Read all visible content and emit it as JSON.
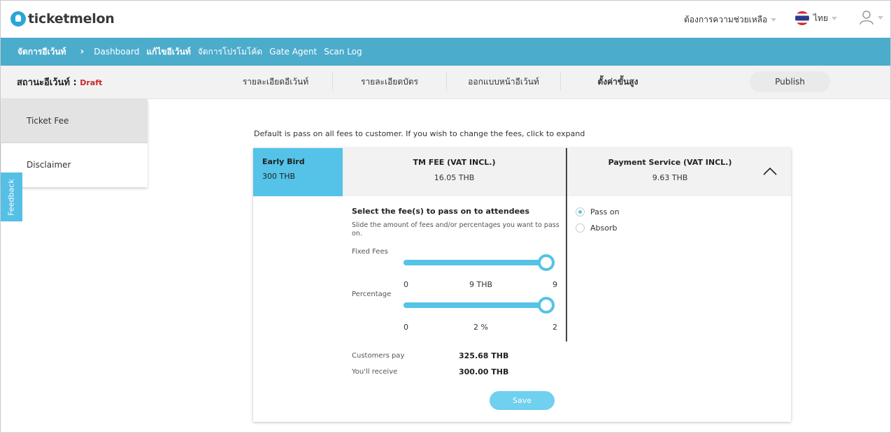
{
  "header": {
    "logo_text": "ticketmelon",
    "help_label": "ต้องการความช่วยเหลือ",
    "language_label": "ไทย"
  },
  "nav": {
    "root": "จัดการอีเว้นท์",
    "items": [
      {
        "label": "Dashboard",
        "active": false
      },
      {
        "label": "แก้ไขอีเว้นท์",
        "active": true
      },
      {
        "label": "จัดการโปรโมโค้ด",
        "active": false
      },
      {
        "label": "Gate Agent",
        "active": false
      },
      {
        "label": "Scan Log",
        "active": false
      }
    ]
  },
  "status": {
    "label": "สถานะอีเว้นท์ : ",
    "value": "Draft",
    "tabs": [
      "รายละเอียดอีเว้นท์",
      "รายละเอียดบัตร",
      "ออกแบบหน้าอีเว้นท์",
      "ตั้งค่าขั้นสูง"
    ],
    "active_tab": 3,
    "publish_label": "Publish"
  },
  "sidebar": {
    "items": [
      "Ticket Fee",
      "Disclaimer"
    ],
    "active": 0
  },
  "feedback_label": "Feedback",
  "main": {
    "intro": "Default is pass on all fees to customer. If you wish to change the fees, click to expand",
    "ticket": {
      "name": "Early Bird",
      "price": "300 THB"
    },
    "tm_fee": {
      "title": "TM FEE (VAT INCL.)",
      "value": "16.05 THB"
    },
    "payment_fee": {
      "title": "Payment Service (VAT INCL.)",
      "value": "9.63 THB"
    },
    "select_title": "Select the fee(s) to pass on to attendees",
    "select_desc": "Slide the amount of fees and/or percentages you want to pass on.",
    "fixed": {
      "label": "Fixed Fees",
      "min": "0",
      "current": "9 THB",
      "max": "9",
      "fraction": 1.0
    },
    "percentage": {
      "label": "Percentage",
      "min": "0",
      "current": "2 %",
      "max": "2",
      "fraction": 1.0
    },
    "radio": {
      "pass_on": "Pass on",
      "absorb": "Absorb",
      "selected": "pass_on"
    },
    "summary": {
      "customers_pay_label": "Customers pay",
      "customers_pay_value": "325.68 THB",
      "receive_label": "You'll receive",
      "receive_value": "300.00 THB"
    },
    "save_label": "Save"
  },
  "colors": {
    "nav_bg": "#4caccc",
    "accent": "#55c3e8",
    "draft": "#c62828"
  }
}
